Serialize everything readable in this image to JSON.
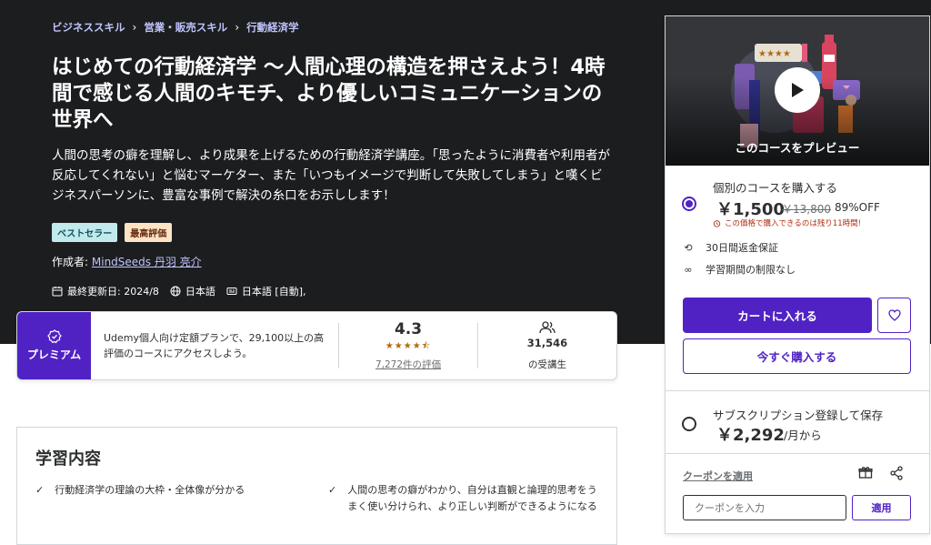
{
  "breadcrumb": [
    {
      "label": "ビジネススキル"
    },
    {
      "label": "営業・販売スキル"
    },
    {
      "label": "行動経済学"
    }
  ],
  "course": {
    "title": "はじめての行動経済学 〜人間心理の構造を押さえよう！4時間で感じる人間のキモチ、より優しいコミュニケーションの世界へ",
    "subtitle": "人間の思考の癖を理解し、より成果を上げるための行動経済学講座。「思ったように消費者や利用者が反応してくれない」と悩むマーケター、また「いつもイメージで判断して失敗してしまう」と嘆くビジネスパーソンに、豊富な事例で解決の糸口をお示しします！",
    "badges": {
      "bestseller": "ベストセラー",
      "top_rated": "最高評価"
    },
    "author_prefix": "作成者:",
    "author_name": "MindSeeds 丹羽 亮介",
    "last_updated": "最終更新日: 2024/8",
    "language": "日本語",
    "captions": "日本語 [自動],"
  },
  "premium": {
    "badge_label": "プレミアム",
    "description": "Udemy個人向け定額プランで、29,100以上の高評価のコースにアクセスしよう。",
    "rating": "4.3",
    "stars": "★★★★⯪",
    "rating_count": "7,272件の評価",
    "students_count": "31,546",
    "students_label": "の受講生"
  },
  "learn": {
    "title": "学習内容",
    "items": [
      "行動経済学の理論の大枠・全体像が分かる",
      "人間の思考の癖がわかり、自分は直観と論理的思考をうまく使い分けられ、より正しい判断ができるようになる"
    ]
  },
  "sidebar": {
    "preview_label": "このコースをプレビュー",
    "purchase_option_label": "個別のコースを購入する",
    "price": "￥1,500",
    "original_price": "￥13,800",
    "discount": "89%OFF",
    "timer_text": "この価格で購入できるのは残り11時間!",
    "features": [
      "30日間返金保証",
      "学習期間の制限なし"
    ],
    "add_to_cart": "カートに入れる",
    "buy_now": "今すぐ購入する",
    "subscription_label": "サブスクリプション登録して保存",
    "subscription_price": "￥2,292",
    "subscription_per": "/月から",
    "coupon_link": "クーポンを適用",
    "coupon_placeholder": "クーポンを入力",
    "coupon_apply": "適用"
  },
  "colors": {
    "accent": "#5022c3",
    "hero_bg": "#1c1d1f",
    "link_light": "#c0c4fc",
    "star": "#b4690e",
    "warning": "#b32d0f"
  }
}
